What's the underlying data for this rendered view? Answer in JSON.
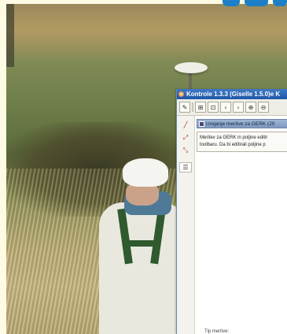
{
  "window": {
    "title": "Kontrole 1.3.3 (Giselle 1.5.0)e  K"
  },
  "toolbar": {
    "buttons": [
      {
        "icon": "pencil-icon",
        "glyph": "✎"
      },
      {
        "icon": "zoom-layer-icon",
        "glyph": "⊞"
      },
      {
        "icon": "zoom-box-icon",
        "glyph": "⊡"
      },
      {
        "icon": "back-icon",
        "glyph": "‹"
      },
      {
        "icon": "forward-icon",
        "glyph": "›"
      },
      {
        "icon": "zoom-in-icon",
        "glyph": "⊕"
      },
      {
        "icon": "zoom-out-icon",
        "glyph": "⊖"
      }
    ]
  },
  "sidebar": {
    "tools": [
      {
        "icon": "draw-line-icon",
        "glyph": "╱"
      },
      {
        "icon": "edit-vertex-icon",
        "glyph": "⤢"
      },
      {
        "icon": "split-line-icon",
        "glyph": "⤡"
      },
      {
        "icon": "list-icon",
        "glyph": "☰"
      }
    ]
  },
  "panel": {
    "header": "Urejanje meritve za GERK (20",
    "info_line1": "Meritev za GERK in poljine editir",
    "info_line2": "toolbaru. Da bi editirali poljine p"
  },
  "footer": {
    "label": "Tip meritve:"
  },
  "colors": {
    "titlebar": "#1e57a8",
    "logo": "#1d7fc7",
    "page_background": "#fdfbe3"
  }
}
